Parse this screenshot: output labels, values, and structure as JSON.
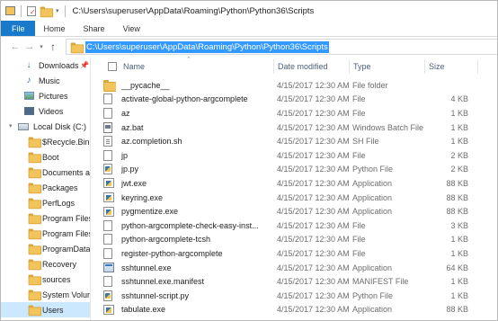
{
  "window": {
    "title_path": "C:\\Users\\superuser\\AppData\\Roaming\\Python\\Python36\\Scripts"
  },
  "ribbon": {
    "tabs": [
      "File",
      "Home",
      "Share",
      "View"
    ]
  },
  "address": {
    "value": "C:\\Users\\superuser\\AppData\\Roaming\\Python\\Python36\\Scripts"
  },
  "nav": {
    "items": [
      {
        "label": "Downloads",
        "icon": "download-icon",
        "pinned": true
      },
      {
        "label": "Music",
        "icon": "music-icon",
        "pinned": true
      },
      {
        "label": "Pictures",
        "icon": "pictures-icon",
        "pinned": true
      },
      {
        "label": "Videos",
        "icon": "videos-icon",
        "pinned": false
      },
      {
        "label": "Local Disk (C:)",
        "icon": "drive-icon",
        "pinned": false
      },
      {
        "label": "$Recycle.Bin",
        "icon": "folder-icon"
      },
      {
        "label": "Boot",
        "icon": "folder-icon"
      },
      {
        "label": "Documents an",
        "icon": "folder-shortcut-icon"
      },
      {
        "label": "Packages",
        "icon": "folder-icon"
      },
      {
        "label": "PerfLogs",
        "icon": "folder-icon"
      },
      {
        "label": "Program Files",
        "icon": "folder-icon"
      },
      {
        "label": "Program Files (",
        "icon": "folder-icon"
      },
      {
        "label": "ProgramData",
        "icon": "folder-icon"
      },
      {
        "label": "Recovery",
        "icon": "folder-icon"
      },
      {
        "label": "sources",
        "icon": "folder-icon"
      },
      {
        "label": "System Volume",
        "icon": "folder-icon"
      },
      {
        "label": "Users",
        "icon": "folder-icon",
        "selected": true
      }
    ]
  },
  "columns": {
    "name": "Name",
    "date": "Date modified",
    "type": "Type",
    "size": "Size"
  },
  "files": [
    {
      "name": "__pycache__",
      "date": "4/15/2017 12:30 AM",
      "type": "File folder",
      "size": "",
      "icon": "folder-icon"
    },
    {
      "name": "activate-global-python-argcomplete",
      "date": "4/15/2017 12:30 AM",
      "type": "File",
      "size": "4 KB",
      "icon": "file-icon"
    },
    {
      "name": "az",
      "date": "4/15/2017 12:30 AM",
      "type": "File",
      "size": "1 KB",
      "icon": "file-icon"
    },
    {
      "name": "az.bat",
      "date": "4/15/2017 12:30 AM",
      "type": "Windows Batch File",
      "size": "1 KB",
      "icon": "batch-file-icon"
    },
    {
      "name": "az.completion.sh",
      "date": "4/15/2017 12:30 AM",
      "type": "SH File",
      "size": "1 KB",
      "icon": "sh-file-icon"
    },
    {
      "name": "jp",
      "date": "4/15/2017 12:30 AM",
      "type": "File",
      "size": "2 KB",
      "icon": "file-icon"
    },
    {
      "name": "jp.py",
      "date": "4/15/2017 12:30 AM",
      "type": "Python File",
      "size": "2 KB",
      "icon": "python-file-icon"
    },
    {
      "name": "jwt.exe",
      "date": "4/15/2017 12:30 AM",
      "type": "Application",
      "size": "88 KB",
      "icon": "python-exe-icon"
    },
    {
      "name": "keyring.exe",
      "date": "4/15/2017 12:30 AM",
      "type": "Application",
      "size": "88 KB",
      "icon": "python-exe-icon"
    },
    {
      "name": "pygmentize.exe",
      "date": "4/15/2017 12:30 AM",
      "type": "Application",
      "size": "88 KB",
      "icon": "python-exe-icon"
    },
    {
      "name": "python-argcomplete-check-easy-inst...",
      "date": "4/15/2017 12:30 AM",
      "type": "File",
      "size": "3 KB",
      "icon": "file-icon"
    },
    {
      "name": "python-argcomplete-tcsh",
      "date": "4/15/2017 12:30 AM",
      "type": "File",
      "size": "1 KB",
      "icon": "file-icon"
    },
    {
      "name": "register-python-argcomplete",
      "date": "4/15/2017 12:30 AM",
      "type": "File",
      "size": "1 KB",
      "icon": "file-icon"
    },
    {
      "name": "sshtunnel.exe",
      "date": "4/15/2017 12:30 AM",
      "type": "Application",
      "size": "64 KB",
      "icon": "exe-icon"
    },
    {
      "name": "sshtunnel.exe.manifest",
      "date": "4/15/2017 12:30 AM",
      "type": "MANIFEST File",
      "size": "1 KB",
      "icon": "file-icon"
    },
    {
      "name": "sshtunnel-script.py",
      "date": "4/15/2017 12:30 AM",
      "type": "Python File",
      "size": "1 KB",
      "icon": "python-file-icon"
    },
    {
      "name": "tabulate.exe",
      "date": "4/15/2017 12:30 AM",
      "type": "Application",
      "size": "88 KB",
      "icon": "python-exe-icon"
    }
  ],
  "colors": {
    "file_tab": "#1979ca",
    "selection": "#3399ff",
    "nav_selected": "#cce8ff",
    "folder": "#f2c55c",
    "header_text": "#4c607a"
  }
}
